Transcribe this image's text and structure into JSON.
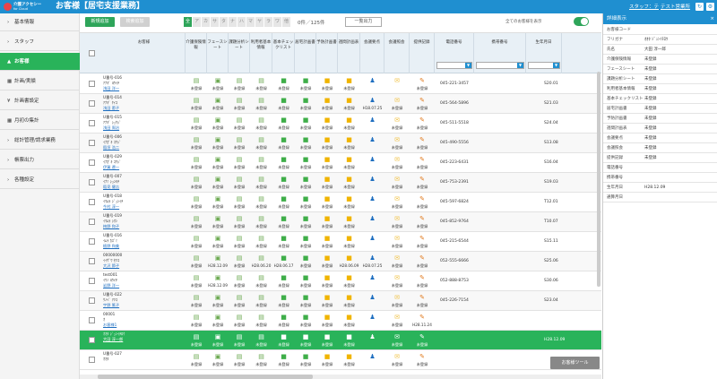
{
  "header": {
    "logo": "介護アクセシー",
    "logo_sub": "for Cloud",
    "title": "お客様【居宅支援業務】",
    "staff_link": "スタッフ：テ",
    "office_link": "テスト営業所",
    "refresh_icon": "refresh-icon",
    "settings_icon": "gear-icon"
  },
  "sidebar": {
    "items": [
      {
        "label": "基本情報",
        "prefix": "›"
      },
      {
        "label": "スタッフ",
        "prefix": "›"
      },
      {
        "label": "お客様",
        "prefix": "▲"
      },
      {
        "label": "計画/実績",
        "prefix": "▦"
      },
      {
        "label": "計画書設定",
        "prefix": "¥"
      },
      {
        "label": "月初の集計",
        "prefix": "▦"
      },
      {
        "label": "総計管理/請求業務",
        "prefix": "›"
      },
      {
        "label": "帳票出力",
        "prefix": "›"
      },
      {
        "label": "各種設定",
        "prefix": "›"
      }
    ]
  },
  "toolbar": {
    "new_label": "新規追加",
    "search_label": "検索追加",
    "kana": [
      "全",
      "ア",
      "カ",
      "サ",
      "タ",
      "ナ",
      "ハ",
      "マ",
      "ヤ",
      "ラ",
      "ワ",
      "他"
    ],
    "count": "0件／125件",
    "export_label": "一覧出力",
    "show_all_label": "全てのお客様を表示"
  },
  "columns": [
    "お客様",
    "介護保険情報",
    "フェースシート",
    "課題分析シート",
    "利用者基本情報",
    "基本チェックリスト",
    "居宅計画書",
    "予防計画書",
    "週間計画表",
    "会議要点",
    "会議照会",
    "提供記録",
    "電話番号",
    "携帯番号",
    "生年月日"
  ],
  "rows": [
    {
      "id": "U番号-016",
      "kana": "ｱﾅｷﾞ ﾖｳｲﾁ",
      "name": "浅田 洋一",
      "status": [
        "未登録",
        "未登録",
        "未登録",
        "未登録",
        "未登録",
        "未登録",
        "未登録",
        "未登録",
        "",
        "",
        "未登録"
      ],
      "phone": "045-221-3457",
      "birth": "S20.01"
    },
    {
      "id": "U番号-014",
      "kana": "ｱﾅｷﾞ ｹｲｺ",
      "name": "浅田 蕙子",
      "status": [
        "未登録",
        "未登録",
        "未登録",
        "未登録",
        "未登録",
        "未登録",
        "未登録",
        "未登録",
        "H18.07.25",
        "未登録",
        "未登録"
      ],
      "phone": "045-564-5896",
      "birth": "S21.03"
    },
    {
      "id": "U番号-015",
      "kana": "ｱﾅｷﾞ ｼｭｳｼﾞ",
      "name": "浅田 周治",
      "status": [
        "未登録",
        "未登録",
        "未登録",
        "未登録",
        "未登録",
        "未登録",
        "未登録",
        "未登録",
        "",
        "未登録",
        "未登録"
      ],
      "phone": "045-511-5518",
      "birth": "S24.04"
    },
    {
      "id": "U番号-006",
      "kana": "ｲﾅｶﾞｷ ｺｳｼﾞ",
      "name": "稲垣 浩二",
      "status": [
        "未登録",
        "未登録",
        "未登録",
        "未登録",
        "未登録",
        "未登録",
        "未登録",
        "未登録",
        "",
        "未登録",
        "未登録"
      ],
      "phone": "045-490-5556",
      "birth": "S13.08"
    },
    {
      "id": "U番号-029",
      "kana": "ｲﾅｶﾞｷ ｺｳｼﾞ",
      "name": "伊賀 遼一",
      "status": [
        "未登録",
        "未登録",
        "未登録",
        "未登録",
        "未登録",
        "未登録",
        "未登録",
        "未登録",
        "",
        "未登録",
        "未登録"
      ],
      "phone": "045-223-6431",
      "birth": "S16.04"
    },
    {
      "id": "U番号-007",
      "kana": "ｲﾅﾐ ｼｭﾝｷﾁ",
      "name": "稲見 健吉",
      "status": [
        "未登録",
        "未登録",
        "未登録",
        "未登録",
        "未登録",
        "未登録",
        "未登録",
        "未登録",
        "",
        "未登録",
        "未登録"
      ],
      "phone": "045-753-2391",
      "birth": "S19.03"
    },
    {
      "id": "U番号-018",
      "kana": "ｲﾏﾑﾗ ｼﾞｭﾝｲﾁ",
      "name": "今村 淳一",
      "status": [
        "未登録",
        "未登録",
        "未登録",
        "未登録",
        "未登録",
        "未登録",
        "未登録",
        "未登録",
        "",
        "未登録",
        "未登録"
      ],
      "phone": "045-597-6824",
      "birth": "T12.01"
    },
    {
      "id": "U番号-019",
      "kana": "ｲﾏﾑﾗ ｼｵﾝ",
      "name": "梅野 和子",
      "status": [
        "未登録",
        "未登録",
        "未登録",
        "未登録",
        "未登録",
        "未登録",
        "未登録",
        "未登録",
        "",
        "未登録",
        "未登録"
      ],
      "phone": "045-852-9764",
      "birth": "T10.07"
    },
    {
      "id": "U番号-016",
      "kana": "ｲﾑﾗ ｶｽﾞﾐ",
      "name": "植野 和美",
      "status": [
        "未登録",
        "未登録",
        "未登録",
        "未登録",
        "未登録",
        "未登録",
        "未登録",
        "未登録",
        "",
        "未登録",
        "未登録"
      ],
      "phone": "045-215-6544",
      "birth": "S15.11"
    },
    {
      "id": "00000000",
      "kana": "ｲｲｻﾞﾜ ｾﾂｺ",
      "name": "大沢 節子",
      "status": [
        "未登録",
        "H28.12.09",
        "未登録",
        "H28.06.20",
        "H28.06.17",
        "未登録",
        "未登録",
        "H28.06.09",
        "H28.07.25",
        "未登録",
        "未登録"
      ],
      "phone": "052-555-6666",
      "birth": "S25.06"
    },
    {
      "id": "test001",
      "kana": "ｲﾜﾉ ﾖｳｲﾁ",
      "name": "岩野 洋一",
      "status": [
        "未登録",
        "H28.12.09",
        "未登録",
        "未登録",
        "未登録",
        "未登録",
        "未登録",
        "未登録",
        "",
        "未登録",
        "未登録"
      ],
      "phone": "052-888-8753",
      "birth": "S30.06"
    },
    {
      "id": "U番号-022",
      "kana": "ｳﾉﾍﾞ ｱﾂｺ",
      "name": "宇野 篤子",
      "status": [
        "未登録",
        "未登録",
        "未登録",
        "未登録",
        "未登録",
        "未登録",
        "未登録",
        "未登録",
        "",
        "未登録",
        "未登録"
      ],
      "phone": "045-226-7154",
      "birth": "S23.04"
    },
    {
      "id": "00001",
      "kana": "ｵ",
      "name": "お客様1",
      "status": [
        "未登録",
        "未登録",
        "未登録",
        "未登録",
        "未登録",
        "未登録",
        "未登録",
        "未登録",
        "",
        "未登録",
        "H28.11.24"
      ],
      "phone": "",
      "birth": ""
    },
    {
      "id": "",
      "kana": "ｵｵﾀ ｼﾞｭﾝｲﾁﾛｳ",
      "name": "大田 淳一郎",
      "status": [
        "未登録",
        "未登録",
        "未登録",
        "未登録",
        "未登録",
        "未登録",
        "未登録",
        "未登録",
        "",
        "未登録",
        "未登録"
      ],
      "phone": "",
      "birth": "H28.12.09"
    },
    {
      "id": "U番号-027",
      "kana": "ｵｵﾀ",
      "name": "",
      "status": [
        "未登録",
        "未登録",
        "未登録",
        "未登録",
        "未登録",
        "未登録",
        "未登録",
        "未登録",
        "",
        "未登録",
        "未登録"
      ],
      "phone": "",
      "birth": ""
    }
  ],
  "detail": {
    "title": "詳細表示",
    "close": "×",
    "items": [
      {
        "k": "お客様コード",
        "v": ""
      },
      {
        "k": "フリガナ",
        "v": "ｵｵﾀ ｼﾞｭﾝｲﾁﾛｳ"
      },
      {
        "k": "氏名",
        "v": "大田 淳一郎"
      },
      {
        "k": "介護保険情報",
        "v": "未登録"
      },
      {
        "k": "フェースシート",
        "v": "未登録"
      },
      {
        "k": "課題分析シート",
        "v": "未登録"
      },
      {
        "k": "利用者基本情報",
        "v": "未登録"
      },
      {
        "k": "基本チェックリスト",
        "v": "未登録"
      },
      {
        "k": "居宅計画書",
        "v": "未登録"
      },
      {
        "k": "予防計画書",
        "v": "未登録"
      },
      {
        "k": "週間計画表",
        "v": "未登録"
      },
      {
        "k": "会議要点",
        "v": "未登録"
      },
      {
        "k": "会議照会",
        "v": "未登録"
      },
      {
        "k": "提供記録",
        "v": "未登録"
      },
      {
        "k": "電話番号",
        "v": ""
      },
      {
        "k": "携帯番号",
        "v": ""
      },
      {
        "k": "生年月日",
        "v": "H28.12.09"
      },
      {
        "k": "通算月日",
        "v": ""
      }
    ]
  },
  "float_button": "お客様ツール",
  "icon_colors": {
    "doc": "#6aa84f",
    "green_box": "#3fae49",
    "yellow": "#f0b400",
    "blue_person": "#1f6fc0",
    "note": "#f0c040",
    "pencil": "#e07a1f"
  }
}
